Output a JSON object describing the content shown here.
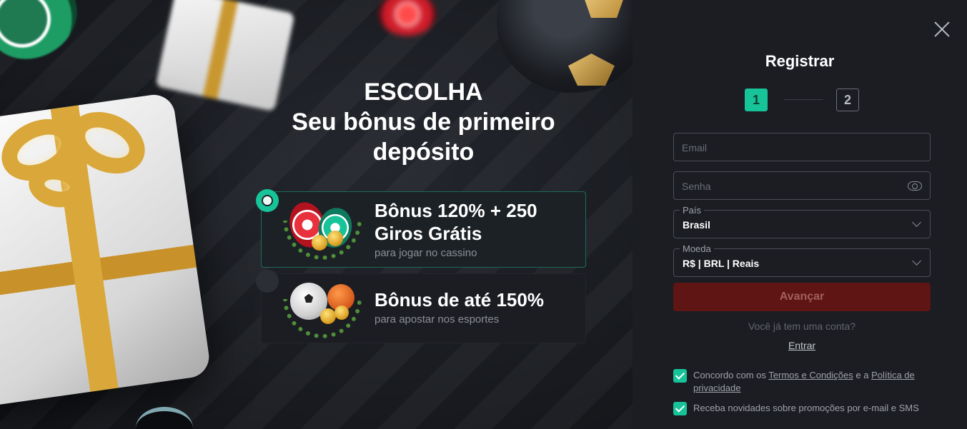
{
  "promo": {
    "headline_1": "ESCOLHA",
    "headline_2": "Seu bônus de primeiro",
    "headline_3": "depósito",
    "options": [
      {
        "title": "Bônus 120% + 250 Giros Grátis",
        "subtitle": "para jogar no cassino",
        "selected": true,
        "icon": "casino-chips-coins-icon"
      },
      {
        "title": "Bônus de até 150%",
        "subtitle": "para apostar nos esportes",
        "selected": false,
        "icon": "sports-balls-icon"
      }
    ]
  },
  "register": {
    "title": "Registrar",
    "step_1": "1",
    "step_2": "2",
    "email_placeholder": "Email",
    "password_placeholder": "Senha",
    "country_label": "País",
    "country_value": "Brasil",
    "currency_label": "Moeda",
    "currency_value": "R$ | BRL | Reais",
    "submit_label": "Avançar",
    "have_account": "Você já tem uma conta?",
    "login_link": "Entrar",
    "terms_prefix": "Concordo com os ",
    "terms_link": "Termos e Condições",
    "terms_mid": " e a ",
    "privacy_link": "Política de privacidade",
    "news_text": "Receba novidades sobre promoções por e-mail e SMS"
  },
  "colors": {
    "accent": "#17c399",
    "button_bg": "#5e1514",
    "panel_bg": "#1b1d22"
  }
}
